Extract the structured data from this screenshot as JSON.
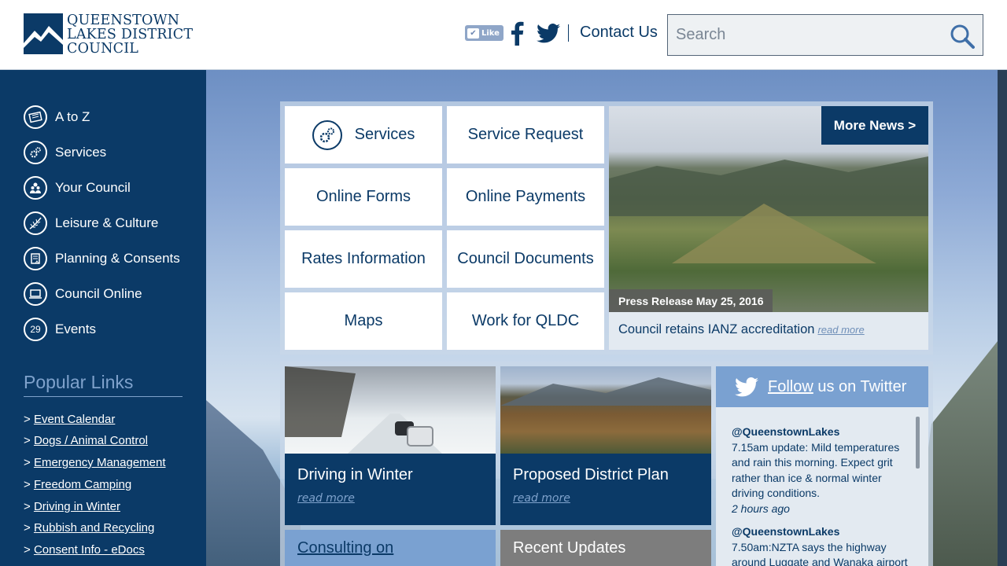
{
  "header": {
    "logo_lines": [
      "QUEENSTOWN",
      "LAKES DISTRICT",
      "COUNCIL"
    ],
    "like_label": "Like",
    "contact_label": "Contact Us",
    "search_placeholder": "Search"
  },
  "sidebar": {
    "items": [
      {
        "label": "A to Z",
        "icon": "book-icon"
      },
      {
        "label": "Services",
        "icon": "gears-icon"
      },
      {
        "label": "Your Council",
        "icon": "people-icon"
      },
      {
        "label": "Leisure & Culture",
        "icon": "fern-icon"
      },
      {
        "label": "Planning & Consents",
        "icon": "document-icon"
      },
      {
        "label": "Council Online",
        "icon": "laptop-icon"
      },
      {
        "label": "Events",
        "icon": "calendar-icon",
        "badge": "29"
      }
    ],
    "popular_title": "Popular Links",
    "popular_links": [
      "Event Calendar",
      "Dogs / Animal Control",
      "Emergency Management",
      "Freedom Camping",
      "Driving in Winter",
      "Rubbish and Recycling",
      "Consent Info - eDocs"
    ]
  },
  "quick_links": [
    "Services",
    "Service Request",
    "Online Forms",
    "Online Payments",
    "Rates Information",
    "Council Documents",
    "Maps",
    "Work for QLDC"
  ],
  "news": {
    "more_label": "More News >",
    "press_tag": "Press Release May 25, 2016",
    "title": "Council retains IANZ accreditation",
    "read_more": "read more"
  },
  "cards": [
    {
      "title": "Driving in Winter",
      "read_more": "read more"
    },
    {
      "title": "Proposed District Plan",
      "read_more": "read more"
    }
  ],
  "twitter": {
    "follow": "Follow",
    "rest": " us on Twitter",
    "tweets": [
      {
        "handle": "@QueenstownLakes",
        "text": "7.15am update: Mild temperatures and rain this morning. Expect grit rather than ice & normal winter driving conditions.",
        "time": "2 hours ago"
      },
      {
        "handle": "@QueenstownLakes",
        "text": "7.50am:NZTA says the highway around Luggate and Wanaka airport"
      }
    ]
  },
  "bottom": {
    "consult": "Consulting on",
    "recent": "Recent Updates"
  },
  "colors": {
    "navy": "#0b3a67",
    "light_blue": "#7aa1d1",
    "pale": "#e3eaf1"
  }
}
